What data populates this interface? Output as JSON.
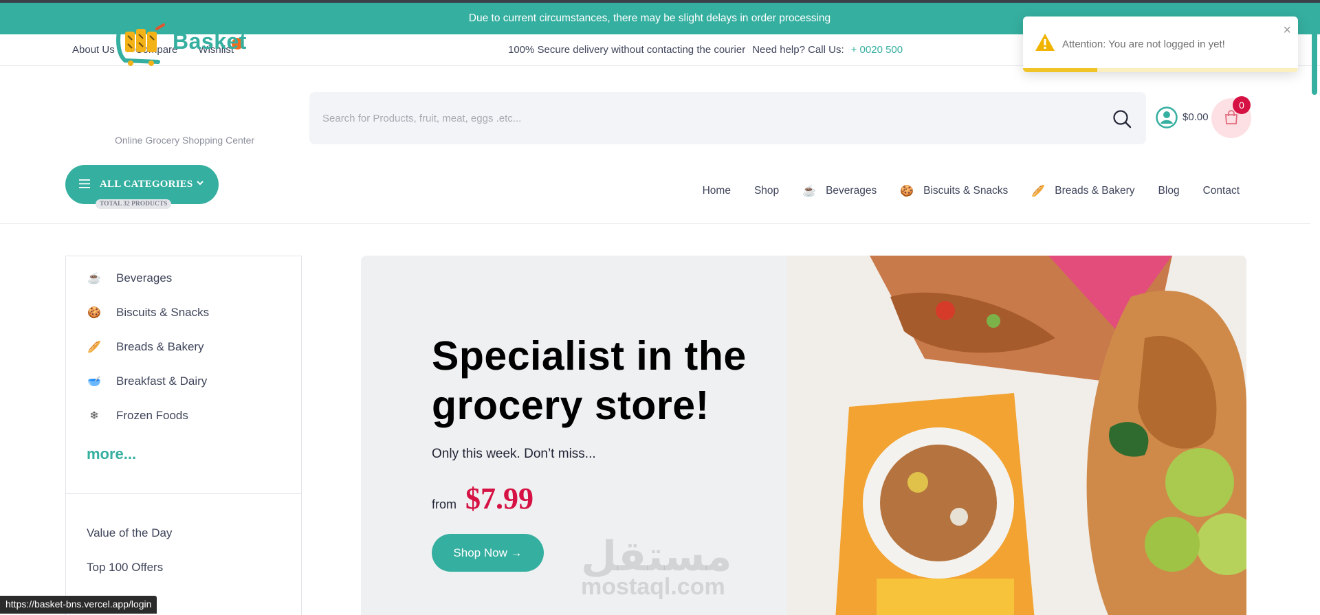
{
  "announcement": "Due to current circumstances, there may be slight delays in order processing",
  "topbar": {
    "links": [
      "About Us",
      "Compare",
      "Wishlist"
    ],
    "secure": "100% Secure delivery without contacting the courier",
    "help": "Need help? Call Us:",
    "phone": "+ 0020 500"
  },
  "logo": {
    "name": "Basket",
    "tagline": "Online Grocery Shopping Center"
  },
  "search": {
    "placeholder": "Search for Products, fruit, meat, eggs .etc..."
  },
  "cart": {
    "total": "$0.00",
    "count": "0"
  },
  "toast": {
    "message": "Attention: You are not logged in yet!",
    "close": "×",
    "progress": 0.27
  },
  "categories_button": {
    "label": "ALL CATEGORIES",
    "total": "TOTAL 32 PRODUCTS"
  },
  "nav": [
    {
      "label": "Home",
      "icon": ""
    },
    {
      "label": "Shop",
      "icon": ""
    },
    {
      "label": "Beverages",
      "icon": "☕"
    },
    {
      "label": "Biscuits & Snacks",
      "icon": "🍪"
    },
    {
      "label": "Breads & Bakery",
      "icon": "🥖"
    },
    {
      "label": "Blog",
      "icon": ""
    },
    {
      "label": "Contact",
      "icon": ""
    }
  ],
  "sidebar": {
    "categories": [
      {
        "label": "Beverages",
        "icon": "☕"
      },
      {
        "label": "Biscuits & Snacks",
        "icon": "🍪"
      },
      {
        "label": "Breads & Bakery",
        "icon": "🥖"
      },
      {
        "label": "Breakfast & Dairy",
        "icon": "🥣"
      },
      {
        "label": "Frozen Foods",
        "icon": "❄"
      }
    ],
    "more": "more...",
    "links": [
      "Value of the Day",
      "Top 100 Offers"
    ]
  },
  "hero": {
    "title": "Specialist in the grocery store!",
    "subtitle": "Only this week. Don’t miss...",
    "from": "from",
    "price": "$7.99",
    "button": "Shop Now →"
  },
  "watermark": {
    "arabic": "مستقل",
    "latin": "mostaql.com"
  },
  "status_url": "https://basket-bns.vercel.app/login",
  "colors": {
    "primary": "#35afa0",
    "accent": "#d51243",
    "warning": "#f0c426"
  }
}
